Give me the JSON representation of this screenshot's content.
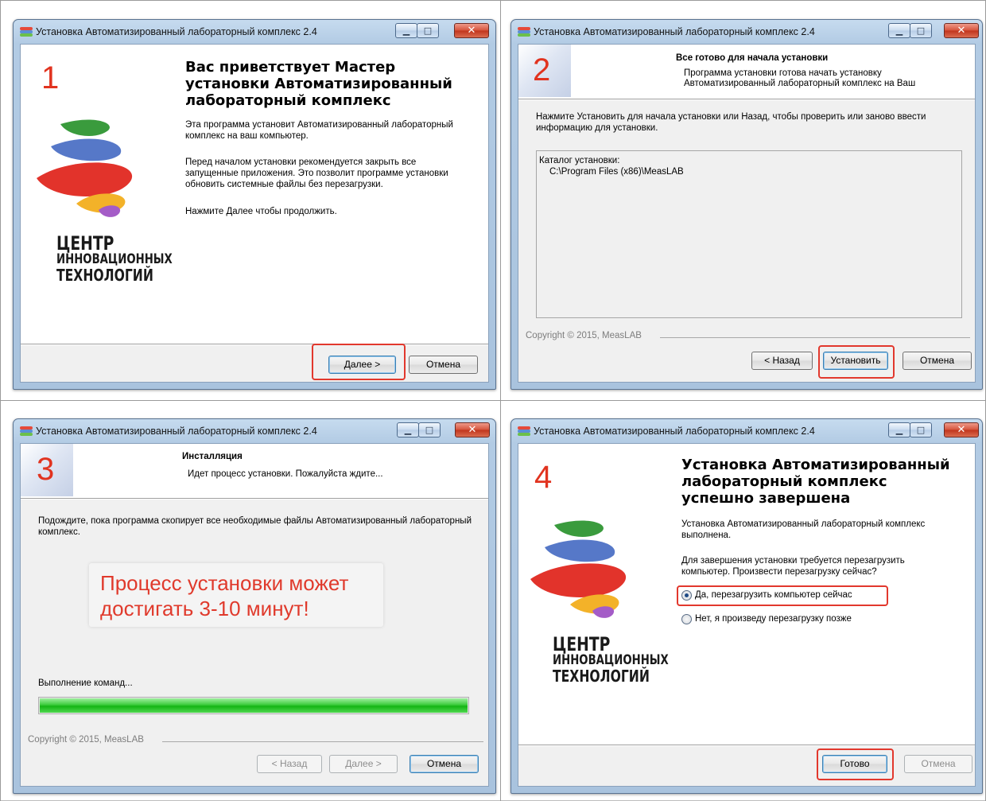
{
  "window_title": "Установка Автоматизированный лабораторный комплекс 2.4",
  "logo": {
    "line1": "ЦЕНТР",
    "line2": "ИННОВАЦИОННЫХ",
    "line3": "ТЕХНОЛОГИЙ"
  },
  "copyright": "Copyright © 2015, MeasLAB",
  "steps": [
    {
      "number": "1",
      "title_lines": [
        "Вас приветствует Мастер",
        "установки Автоматизированный",
        "лабораторный комплекс"
      ],
      "paragraphs": [
        "Эта программа установит Автоматизированный лабораторный комплекс на ваш компьютер.",
        "Перед началом установки рекомендуется закрыть все запущенные приложения. Это позволит программе установки обновить системные файлы без перезагрузки.",
        "Нажмите Далее чтобы продолжить."
      ],
      "buttons": {
        "next": "Далее >",
        "cancel": "Отмена"
      }
    },
    {
      "number": "2",
      "header_title": "Все готово для начала установки",
      "header_sub": "Программа установки готова начать установку Автоматизированный лабораторный комплекс на Ваш",
      "body": "Нажмите Установить для начала установки или Назад, чтобы проверить или заново ввести информацию для установки.",
      "list_label": "Каталог установки:",
      "list_value": "C:\\Program Files (x86)\\MeasLAB",
      "buttons": {
        "back": "< Назад",
        "install": "Установить",
        "cancel": "Отмена"
      }
    },
    {
      "number": "3",
      "header_title": "Инсталляция",
      "header_sub": "Идет процесс установки. Пожалуйста ждите...",
      "body": "Подождите, пока программа скопирует все необходимые файлы Автоматизированный лабораторный комплекс.",
      "callout_lines": [
        "Процесс установки может",
        "достигать 3-10 минут!"
      ],
      "status": "Выполнение команд...",
      "progress": 1.0,
      "buttons": {
        "back": "< Назад",
        "next": "Далее >",
        "cancel": "Отмена"
      }
    },
    {
      "number": "4",
      "title_lines": [
        "Установка Автоматизированный",
        "лабораторный комплекс",
        "успешно завершена"
      ],
      "paragraphs": [
        "Установка Автоматизированный лабораторный комплекс выполнена.",
        "Для завершения установки требуется перезагрузить компьютер. Произвести перезагрузку сейчас?"
      ],
      "radio_yes": "Да, перезагрузить компьютер сейчас",
      "radio_no": "Нет, я произведу перезагрузку позже",
      "selected": "yes",
      "buttons": {
        "finish": "Готово",
        "cancel": "Отмена"
      }
    }
  ],
  "colors": {
    "step_number": "#e1331f",
    "highlight": "#e2382d",
    "progress": "#14b414"
  }
}
